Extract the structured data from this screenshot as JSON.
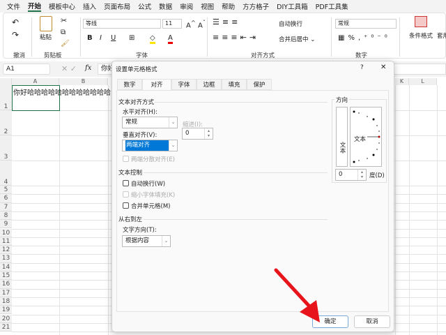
{
  "menu": [
    "文件",
    "开始",
    "模板中心",
    "插入",
    "页面布局",
    "公式",
    "数据",
    "审阅",
    "视图",
    "帮助",
    "方方格子",
    "DIY工具箱",
    "PDF工具集"
  ],
  "menu_active": 1,
  "ribbon": {
    "groups": {
      "undo": "撤消",
      "clipboard": "剪贴板",
      "font": "字体",
      "align": "对齐方式",
      "number": "数字"
    },
    "paste": "粘贴",
    "font_name": "等线",
    "font_size": "11",
    "wrap": "自动换行",
    "merge": "合并后居中",
    "number_format": "常规",
    "cond_format": "条件格式",
    "table_format": "套用表格格式"
  },
  "formula_bar": {
    "name_box": "A1",
    "fx": "fx",
    "content": "你好"
  },
  "sheet": {
    "columns": [
      "A",
      "B",
      "K",
      "L"
    ],
    "rows": [
      "1",
      "2",
      "3",
      "4",
      "5",
      "6",
      "7",
      "8",
      "9",
      "10",
      "11",
      "12",
      "13",
      "14",
      "15",
      "16",
      "17",
      "18",
      "19",
      "20",
      "21"
    ],
    "a1": "你好哈哈哈哈哈哈哈哈哈哈哈哈"
  },
  "dialog": {
    "title": "设置单元格格式",
    "help": "?",
    "close": "✕",
    "tabs": [
      "数字",
      "对齐",
      "字体",
      "边框",
      "填充",
      "保护"
    ],
    "active_tab": 1,
    "text_align_section": "文本对齐方式",
    "horizontal_label": "水平对齐(H):",
    "horizontal_value": "常规",
    "indent_label": "缩进(I):",
    "indent_value": "0",
    "vertical_label": "垂直对齐(V):",
    "vertical_value": "两端对齐",
    "distributed": "两端分散对齐(E)",
    "text_control_section": "文本控制",
    "wrap_text": "自动换行(W)",
    "shrink": "缩小字体填充(K)",
    "merge_cells": "合并单元格(M)",
    "rtl_section": "从右到左",
    "direction_label": "文字方向(T):",
    "direction_value": "根据内容",
    "orientation_section": "方向",
    "vertical_text": "文本",
    "orientation_text": "文本",
    "degrees_value": "0",
    "degrees_label": "度(D)",
    "ok": "确定",
    "cancel": "取消"
  },
  "colors": {
    "accent": "#1e7145",
    "selection": "#0078d7",
    "arrow": "#e8141b"
  }
}
